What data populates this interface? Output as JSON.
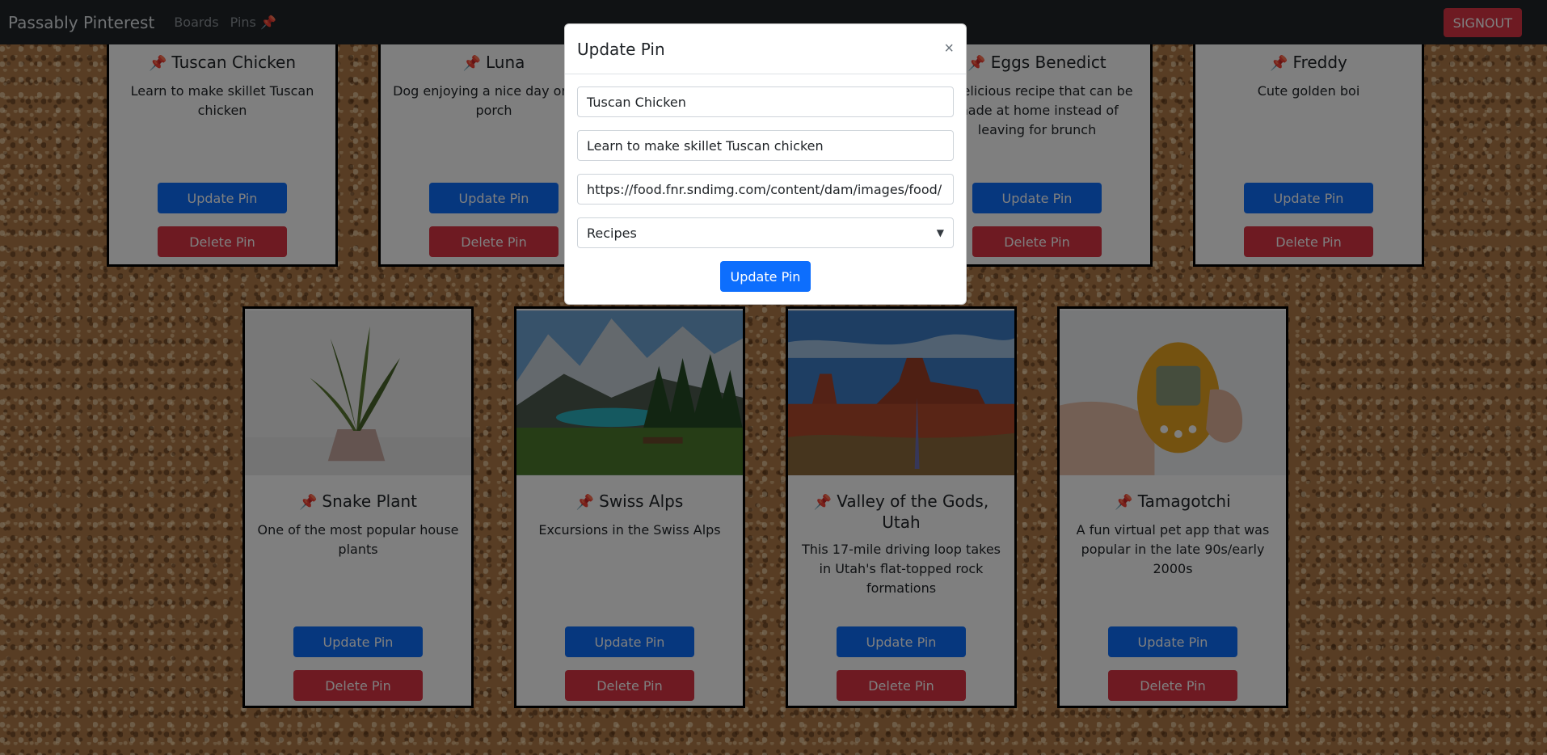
{
  "navbar": {
    "brand": "Passably Pinterest",
    "links": [
      "Boards",
      "Pins"
    ],
    "pin_glyph": "📌",
    "signout": "SIGNOUT"
  },
  "cards_top": [
    {
      "title": "Tuscan Chicken",
      "text": "Learn to make skillet Tuscan chicken"
    },
    {
      "title": "Luna",
      "text": "Dog enjoying a nice day on the porch"
    },
    {
      "title": "",
      "text": ""
    },
    {
      "title": "Eggs Benedict",
      "text": "A delicious recipe that can be made at home instead of leaving for brunch"
    },
    {
      "title": "Freddy",
      "text": "Cute golden boi"
    }
  ],
  "cards_bottom": [
    {
      "title": "Snake Plant",
      "text": "One of the most popular house plants",
      "image": "snake-plant"
    },
    {
      "title": "Swiss Alps",
      "text": "Excursions in the Swiss Alps",
      "image": "swiss-alps"
    },
    {
      "title": "Valley of the Gods, Utah",
      "text": "This 17-mile driving loop takes in Utah's flat-topped rock formations",
      "image": "valley-of-the-gods"
    },
    {
      "title": "Tamagotchi",
      "text": "A fun virtual pet app that was popular in the late 90s/early 2000s",
      "image": "tamagotchi"
    }
  ],
  "buttons": {
    "update": "Update Pin",
    "delete": "Delete Pin"
  },
  "modal": {
    "title": "Update Pin",
    "close": "×",
    "name_value": "Tuscan Chicken",
    "description_value": "Learn to make skillet Tuscan chicken",
    "image_url_value": "https://food.fnr.sndimg.com/content/dam/images/food/",
    "board_selected": "Recipes",
    "submit": "Update Pin"
  },
  "colors": {
    "primary": "#0d6efd",
    "danger": "#dc3545",
    "navbar": "#212529"
  }
}
